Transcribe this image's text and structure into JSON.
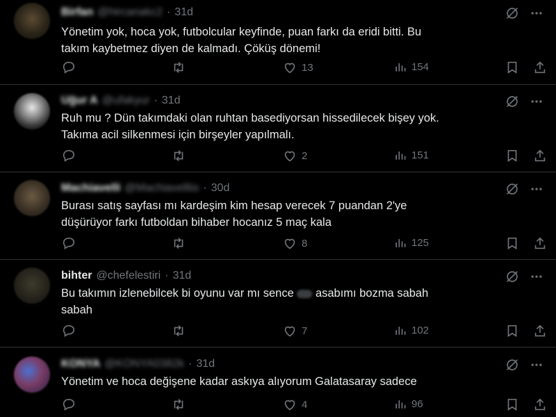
{
  "tweets": [
    {
      "name": "Birfan",
      "handle": "@hircanakc2",
      "time": "31d",
      "lines": [
        "Yönetim yok, hoca yok, futbolcular keyfinde, puan farkı da eridi bitti. Bu",
        "takım kaybetmez diyen de kalmadı. Çöküş dönemi!"
      ],
      "likes": "13",
      "views": "154",
      "name_blurred": true
    },
    {
      "name": "Uğur A",
      "handle": "@ufakyur",
      "time": "31d",
      "lines": [
        "Ruh mu ? Dün takımdaki olan ruhtan basediyorsan hissedilecek bişey yok.",
        "Takıma acil silkenmesi için birşeyler yapılmalı."
      ],
      "likes": "2",
      "views": "151",
      "name_blurred": true
    },
    {
      "name": "Machiavelli",
      "handle": "@Machiavelliis",
      "time": "30d",
      "lines": [
        "Burası satış sayfası mı kardeşim kim hesap verecek 7 puandan 2'ye",
        "düşürüyor farkı futboldan bihaber hocanız 5 maç kala"
      ],
      "likes": "8",
      "views": "125",
      "name_blurred": true
    },
    {
      "name": "bihter",
      "handle": "@chefelestiri",
      "time": "31d",
      "line1_before": "Bu takımın izlenebilcek bi oyunu var mı sence",
      "line1_after": "asabımı bozma sabah",
      "line2": "sabah",
      "likes": "7",
      "views": "102",
      "name_blurred": false
    },
    {
      "name": "KONYA",
      "handle": "@KONYA0382k",
      "time": "31d",
      "lines": [
        "Yönetim ve hoca değişene kadar askıya alıyorum Galatasaray sadece"
      ],
      "likes": "4",
      "views": "96",
      "name_blurred": true
    }
  ],
  "icons": {
    "top": [
      "grok-icon",
      "more-icon"
    ],
    "actions": [
      "reply-icon",
      "retweet-icon",
      "like-icon",
      "views-icon",
      "bookmark-icon",
      "share-icon"
    ]
  },
  "colors": {
    "background": "#000000",
    "text": "#e7e9ea",
    "muted": "#71767b",
    "divider": "#2f3336"
  }
}
